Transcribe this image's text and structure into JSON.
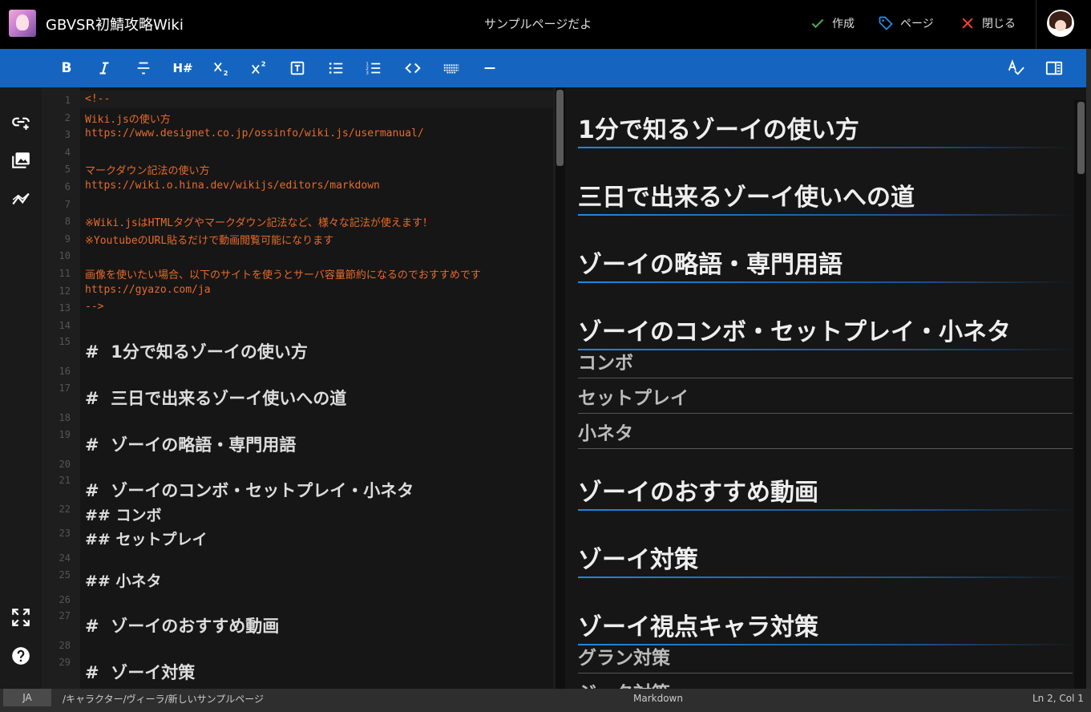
{
  "header": {
    "site_title": "GBVSR初鯖攻略Wiki",
    "page_title": "サンプルページだよ",
    "create_label": "作成",
    "page_label": "ページ",
    "close_label": "閉じる"
  },
  "toolbar": {
    "bold": "B",
    "heading": "H#"
  },
  "editor": {
    "lines": [
      {
        "n": "1",
        "text": "<!--",
        "kind": "code"
      },
      {
        "n": "2",
        "text": "Wiki.jsの使い方",
        "kind": "code"
      },
      {
        "n": "3",
        "text": "https://www.designet.co.jp/ossinfo/wiki.js/usermanual/",
        "kind": "code"
      },
      {
        "n": "4",
        "text": "",
        "kind": "code"
      },
      {
        "n": "5",
        "text": "マークダウン記法の使い方",
        "kind": "code"
      },
      {
        "n": "6",
        "text": "https://wiki.o.hina.dev/wikijs/editors/markdown",
        "kind": "code"
      },
      {
        "n": "7",
        "text": "",
        "kind": "code"
      },
      {
        "n": "8",
        "text": "※Wiki.jsはHTMLタグやマークダウン記法など、様々な記法が使えます！",
        "kind": "code"
      },
      {
        "n": "9",
        "text": "※YoutubeのURL貼るだけで動画閲覧可能になります",
        "kind": "code"
      },
      {
        "n": "10",
        "text": "",
        "kind": "code"
      },
      {
        "n": "11",
        "text": "画像を使いたい場合、以下のサイトを使うとサーバ容量節約になるのでおすすめです",
        "kind": "code"
      },
      {
        "n": "12",
        "text": "https://gyazo.com/ja",
        "kind": "code"
      },
      {
        "n": "13",
        "text": "-->",
        "kind": "code"
      },
      {
        "n": "14",
        "text": "",
        "kind": "code"
      },
      {
        "n": "15",
        "text": "#  1分で知るゾーイの使い方",
        "kind": "h1"
      },
      {
        "n": "16",
        "text": "",
        "kind": "code"
      },
      {
        "n": "17",
        "text": "#  三日で出来るゾーイ使いへの道",
        "kind": "h1"
      },
      {
        "n": "18",
        "text": "",
        "kind": "code"
      },
      {
        "n": "19",
        "text": "#  ゾーイの略語・専門用語",
        "kind": "h1"
      },
      {
        "n": "20",
        "text": "",
        "kind": "code"
      },
      {
        "n": "21",
        "text": "#  ゾーイのコンボ・セットプレイ・小ネタ",
        "kind": "h1"
      },
      {
        "n": "22",
        "text": "## コンボ",
        "kind": "h2"
      },
      {
        "n": "23",
        "text": "## セットプレイ",
        "kind": "h2"
      },
      {
        "n": "24",
        "text": "",
        "kind": "code"
      },
      {
        "n": "25",
        "text": "## 小ネタ",
        "kind": "h2"
      },
      {
        "n": "26",
        "text": "",
        "kind": "code"
      },
      {
        "n": "27",
        "text": "#  ゾーイのおすすめ動画",
        "kind": "h1"
      },
      {
        "n": "28",
        "text": "",
        "kind": "code"
      },
      {
        "n": "29",
        "text": "#  ゾーイ対策",
        "kind": "h1"
      }
    ]
  },
  "preview": {
    "headings": [
      {
        "text": "1分で知るゾーイの使い方",
        "level": 1
      },
      {
        "text": "三日で出来るゾーイ使いへの道",
        "level": 1
      },
      {
        "text": "ゾーイの略語・専門用語",
        "level": 1
      },
      {
        "text": "ゾーイのコンボ・セットプレイ・小ネタ",
        "level": 1
      },
      {
        "text": "コンボ",
        "level": 2
      },
      {
        "text": "セットプレイ",
        "level": 2
      },
      {
        "text": "小ネタ",
        "level": 2
      },
      {
        "text": "ゾーイのおすすめ動画",
        "level": 1
      },
      {
        "text": "ゾーイ対策",
        "level": 1
      },
      {
        "text": "ゾーイ視点キャラ対策",
        "level": 1
      },
      {
        "text": "グラン対策",
        "level": 2
      },
      {
        "text": "ジータ対策",
        "level": 2
      }
    ]
  },
  "status": {
    "lang": "JA",
    "path": "/キャラクター/ヴィーラ/新しいサンプルページ",
    "mode": "Markdown",
    "position": "Ln 2, Col 1"
  },
  "colors": {
    "accent": "#1565c0",
    "comment": "#e86a2a",
    "create": "#4caf50",
    "page": "#2196f3",
    "close": "#f44336"
  }
}
